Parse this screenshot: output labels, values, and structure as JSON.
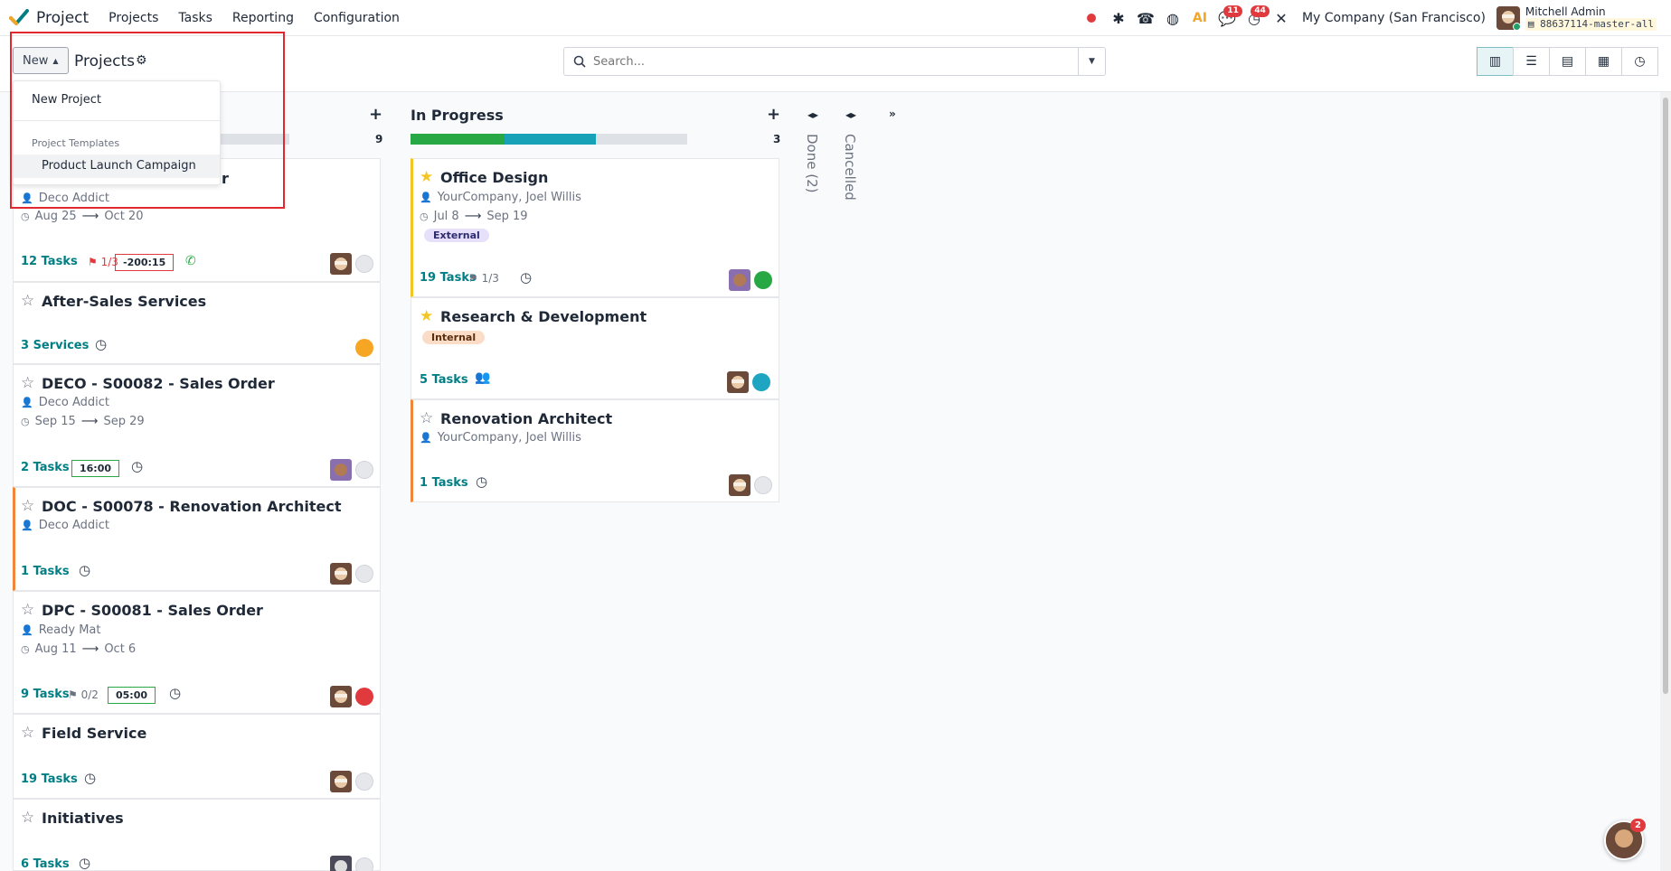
{
  "app": {
    "name": "Project"
  },
  "menu": [
    "Projects",
    "Tasks",
    "Reporting",
    "Configuration"
  ],
  "systray": {
    "messages_badge": "11",
    "activities_badge": "44",
    "company": "My Company (San Francisco)",
    "user_name": "Mitchell Admin",
    "db_name": "88637114-master-all",
    "ai_label": "AI"
  },
  "control": {
    "new_label": "New",
    "title": "Projects",
    "search_placeholder": "Search..."
  },
  "dropdown": {
    "new_project": "New Project",
    "templates_header": "Project Templates",
    "template_item": "Product Launch Campaign"
  },
  "columns": [
    {
      "title": "",
      "count": "9",
      "progress": {
        "green": 0,
        "blue": 0
      }
    },
    {
      "title": "In Progress",
      "count": "3",
      "progress": {
        "green": 0.34,
        "blue": 0.33
      }
    }
  ],
  "folded": [
    "Done (2)",
    "Cancelled"
  ],
  "left_cards": [
    {
      "title": "r",
      "customer": "Deco Addict",
      "start": "Aug 25",
      "end": "Oct 20",
      "tasks": "12 Tasks",
      "milestone": "1/3",
      "time": "-200:15",
      "status_color": "grey"
    },
    {
      "title": "After-Sales Services",
      "tasks": "3 Services",
      "status_color": "orange"
    },
    {
      "title": "DECO - S00082 - Sales Order",
      "customer": "Deco Addict",
      "start": "Sep 15",
      "end": "Sep 29",
      "tasks": "2 Tasks",
      "time": "16:00",
      "status_color": "grey"
    },
    {
      "title": "DOC - S00078 - Renovation Architect",
      "customer": "Deco Addict",
      "tasks": "1 Tasks",
      "status_color": "grey"
    },
    {
      "title": "DPC - S00081 - Sales Order",
      "customer": "Ready Mat",
      "start": "Aug 11",
      "end": "Oct 6",
      "tasks": "9 Tasks",
      "milestone": "0/2",
      "time": "05:00",
      "status_color": "red"
    },
    {
      "title": "Field Service",
      "tasks": "19 Tasks",
      "status_color": "grey"
    },
    {
      "title": "Initiatives",
      "tasks": "6 Tasks",
      "status_color": "grey"
    }
  ],
  "right_cards": [
    {
      "title": "Office Design",
      "customer": "YourCompany, Joel Willis",
      "start": "Jul 8",
      "end": "Sep 19",
      "tag": "External",
      "tasks": "19 Tasks",
      "milestone": "1/3",
      "status_color": "green"
    },
    {
      "title": "Research & Development",
      "tag": "Internal",
      "tasks": "5 Tasks",
      "status_color": "blue"
    },
    {
      "title": "Renovation Architect",
      "customer": "YourCompany, Joel Willis",
      "tasks": "1 Tasks",
      "status_color": "grey"
    }
  ],
  "chat_badge": "2"
}
